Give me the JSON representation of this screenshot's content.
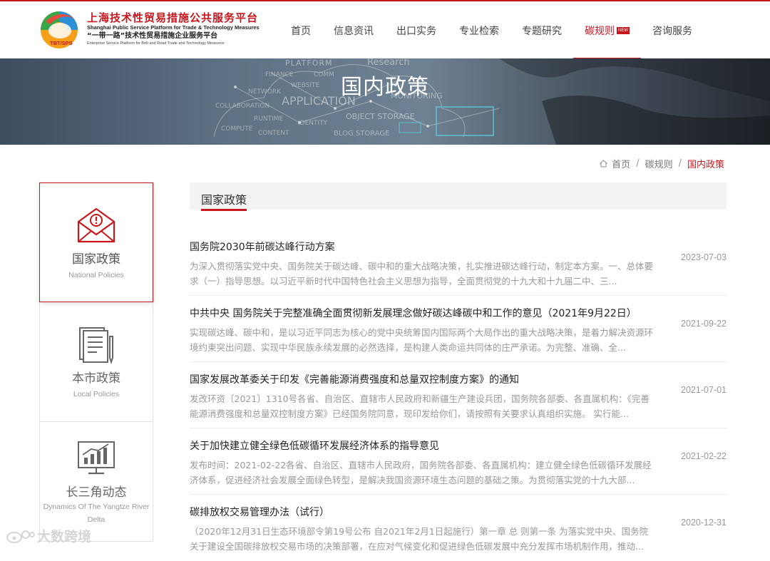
{
  "header": {
    "logo": {
      "badge_text": "TBT/SPS",
      "title_cn": "上海技术性贸易措施公共服务平台",
      "title_en": "Shanghai Public Service Platform for Trade & Technology Measures",
      "subtitle_cn": "“一带一路”技术性贸易措施企业服务平台",
      "subtitle_en": "Enterprise Service Platform for Belt and Road Trade and Technology Measures"
    },
    "nav": [
      {
        "label": "首页"
      },
      {
        "label": "信息资讯"
      },
      {
        "label": "出口实务"
      },
      {
        "label": "专业检索"
      },
      {
        "label": "专题研究"
      },
      {
        "label": "碳规则",
        "badge": "NEW",
        "active": true
      },
      {
        "label": "咨询服务"
      }
    ]
  },
  "banner": {
    "title": "国内政策",
    "bg_words": [
      "PLATFORM",
      "Research",
      "FINANCE",
      "COMM",
      "WEBSITE",
      "NETWORK",
      "APPLICATION",
      "MONITORING",
      "COLLABORATION",
      "RUNTIME",
      "IDENTITY",
      "OBJECT STORAGE",
      "COMPUTE",
      "CONTENT",
      "BLOG STORAGE"
    ]
  },
  "breadcrumb": {
    "home_icon": "home-icon",
    "items": [
      "首页",
      "碳规则",
      "国内政策"
    ],
    "separator": "/"
  },
  "sidebar": {
    "items": [
      {
        "label_cn": "国家政策",
        "label_en": "National Policies",
        "icon": "envelope-alert-icon",
        "active": true
      },
      {
        "label_cn": "本市政策",
        "label_en": "Local Policies",
        "icon": "document-stack-icon",
        "active": false
      },
      {
        "label_cn": "长三角动态",
        "label_en": "Dynamics Of The Yangtze River Delta",
        "icon": "monitor-chart-icon",
        "active": false
      }
    ]
  },
  "section": {
    "title": "国家政策"
  },
  "articles": [
    {
      "title": "国务院2030年前碳达峰行动方案",
      "desc": "为深入贯彻落实党中央、国务院关于碳达峰、碳中和的重大战略决策，扎实推进碳达峰行动，制定本方案。一、总体要求（一）指导思想。以习近平新时代中国特色社会主义思想为指导，全面贯彻党的十九大和十九届二中、三...",
      "date": "2023-07-03"
    },
    {
      "title": "中共中央 国务院关于完整准确全面贯彻新发展理念做好碳达峰碳中和工作的意见（2021年9月22日）",
      "desc": "实现碳达峰、碳中和，是以习近平同志为核心的党中央统筹国内国际两个大局作出的重大战略决策，是着力解决资源环境约束突出问题、实现中华民族永续发展的必然选择，是构建人类命运共同体的庄严承诺。为完整、准确、全...",
      "date": "2021-09-22"
    },
    {
      "title": "国家发展改革委关于印发《完善能源消费强度和总量双控制度方案》的通知",
      "desc": "发改环资〔2021〕1310号各省、自治区、直辖市人民政府和新疆生产建设兵团，国务院各部委、各直属机构：《完善能源消费强度和总量双控制度方案》已经国务院同意，现印发给你们，请按照有关要求认真组织实施。 实行能...",
      "date": "2021-07-01"
    },
    {
      "title": "关于加快建立健全绿色低碳循环发展经济体系的指导意见",
      "desc": "发布时间：2021-02-22各省、自治区、直辖市人民政府，国务院各部委、各直属机构：建立健全绿色低碳循环发展经济体系，促进经济社会发展全面绿色转型，是解决我国资源环境生态问题的基础之策。为贯彻落实党的十九大部...",
      "date": "2021-02-22"
    },
    {
      "title": "碳排放权交易管理办法（试行）",
      "desc": "（2020年12月31日生态环境部令第19号公布 自2021年2月1日起施行）第一章 总 则第一条 为落实党中央、国务院关于建设全国碳排放权交易市场的决策部署，在应对气候变化和促进绿色低碳发展中充分发挥市场机制作用，推动...",
      "date": "2020-12-31"
    }
  ],
  "watermark": {
    "icon": "weibo-icon",
    "text": "大数跨境"
  },
  "colors": {
    "accent": "#c8161d",
    "text": "#333333",
    "muted": "#999999"
  }
}
